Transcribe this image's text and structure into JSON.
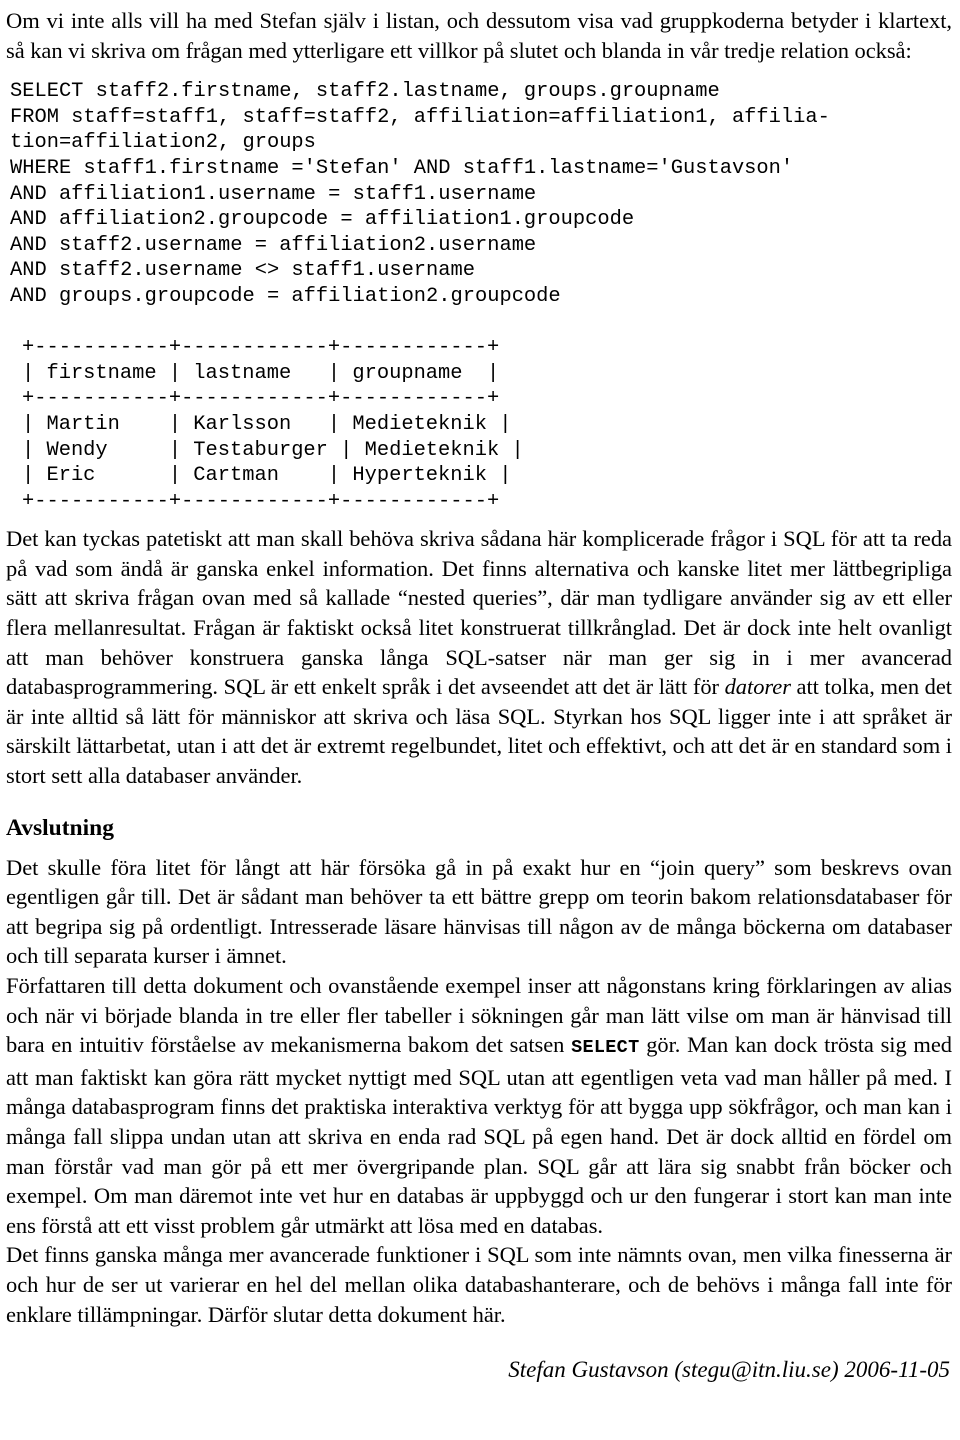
{
  "document": {
    "intro_paragraph": "Om vi inte alls vill ha med Stefan själv i listan, och dessutom visa vad gruppkoderna betyder i klartext, så kan vi skriva om frågan med ytterligare ett villkor på slutet och blanda in vår tredje relation också:",
    "sql_query": "SELECT staff2.firstname, staff2.lastname, groups.groupname\nFROM staff=staff1, staff=staff2, affiliation=affiliation1, affilia-\ntion=affiliation2, groups\nWHERE staff1.firstname ='Stefan' AND staff1.lastname='Gustavson'\nAND affiliation1.username = staff1.username\nAND affiliation2.groupcode = affiliation1.groupcode\nAND staff2.username = affiliation2.username\nAND staff2.username <> staff1.username\nAND groups.groupcode = affiliation2.groupcode",
    "result_table_ascii": "+-----------+------------+------------+\n| firstname | lastname   | groupname  |\n+-----------+------------+------------+\n| Martin    | Karlsson   | Medieteknik |\n| Wendy     | Testaburger | Medieteknik |\n| Eric      | Cartman    | Hyperteknik |\n+-----------+------------+------------+",
    "result_table": {
      "columns": [
        "firstname",
        "lastname",
        "groupname"
      ],
      "rows": [
        [
          "Martin",
          "Karlsson",
          "Medieteknik"
        ],
        [
          "Wendy",
          "Testaburger",
          "Medieteknik"
        ],
        [
          "Eric",
          "Cartman",
          "Hyperteknik"
        ]
      ]
    },
    "paragraph_after_table_part1": "Det kan tyckas patetiskt att man skall behöva skriva sådana här komplicerade frågor i SQL för att ta reda på vad som ändå är ganska enkel information. Det finns alternativa och kanske litet mer lättbegripliga sätt att skriva frågan ovan med så kallade “nested queries”, där man tydligare använder sig av ett eller flera mellanresultat. Frågan är faktiskt också litet konstruerat tillkrånglad. Det är dock inte helt ovanligt att man behöver konstruera ganska långa SQL-satser när man ger sig in i mer avancerad databasprogrammering. SQL är ett enkelt språk i det avseendet att det är lätt för ",
    "paragraph_after_table_italic": "datorer",
    "paragraph_after_table_part2": " att tolka, men det är inte alltid så lätt för människor att skriva och läsa SQL. Styrkan hos SQL ligger inte i att språket är särskilt lättarbetat, utan i att det är extremt regelbundet, litet och effektivt, och att det är en standard som i stort sett alla databaser använder.",
    "section_heading": "Avslutning",
    "closing_paragraph_1": "Det skulle föra litet för långt att här försöka gå in på exakt hur en “join query” som beskrevs ovan egentligen går till. Det är sådant man behöver ta ett bättre grepp om teorin bakom relationsdatabaser för att begripa sig på ordentligt. Intresserade läsare hänvisas till någon av de många böckerna om databaser och till separata kurser i ämnet.",
    "closing_paragraph_2_part1": "Författaren till detta dokument och ovanstående exempel inser att någonstans kring förklaringen av alias och när vi började blanda in tre eller fler tabeller i sökningen går man lätt vilse om man är hänvisad till bara en intuitiv förståelse av mekanismerna bakom det satsen ",
    "closing_paragraph_2_keyword": "SELECT",
    "closing_paragraph_2_part2": " gör. Man kan dock trösta sig med att man faktiskt kan göra rätt mycket nyttigt med SQL utan att egentligen veta vad man håller på med. I många databasprogram finns det praktiska interaktiva verktyg för att bygga upp sökfrågor, och man kan i många fall slippa undan utan att skriva en enda rad SQL på egen hand. Det är dock alltid en fördel om man förstår vad man gör på ett mer övergripande plan. SQL går att lära sig snabbt från böcker och exempel. Om man däremot inte vet hur en databas är uppbyggd och ur den fungerar i stort kan man inte ens förstå att ett visst problem går utmärkt att lösa med en databas.",
    "closing_paragraph_3": "Det finns ganska många mer avancerade funktioner i SQL som inte nämnts ovan, men vilka finesserna är och hur de ser ut varierar en hel del mellan olika databashanterare, och de behövs i många fall inte för enklare tillämpningar. Därför slutar detta dokument här.",
    "footer": "Stefan Gustavson (stegu@itn.liu.se) 2006-11-05"
  },
  "colors": {
    "text": "#000000",
    "background": "#ffffff"
  }
}
